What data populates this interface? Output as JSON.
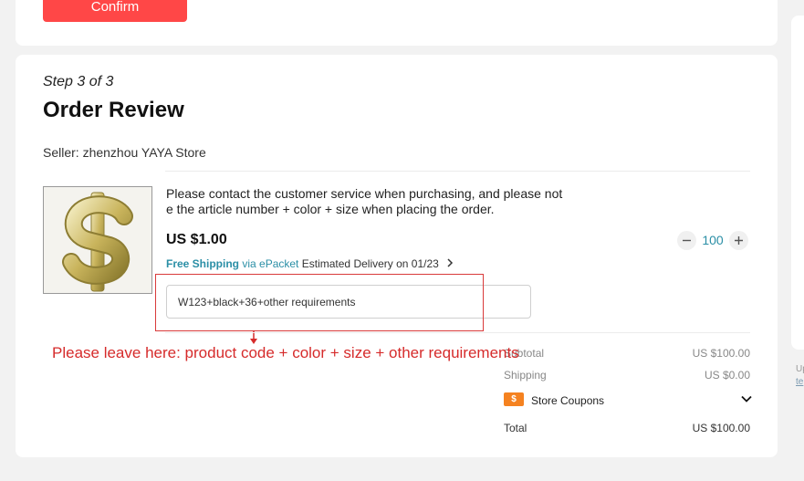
{
  "top": {
    "confirm_label": "Confirm"
  },
  "side": {
    "line1": "Up",
    "line2": "te"
  },
  "order": {
    "step": "Step 3 of 3",
    "title": "Order Review",
    "seller": "Seller: zhenzhou YAYA Store"
  },
  "product": {
    "description_line1": "Please contact the customer service when purchasing, and please not",
    "description_line2": "e the article number + color + size when placing the order.",
    "price": "US $1.00",
    "free_shipping": "Free Shipping",
    "via": "via ePacket",
    "delivery": "Estimated Delivery on 01/23",
    "quantity": "100"
  },
  "remark": {
    "value": "W123+black+36+other requirements"
  },
  "annotation": {
    "text": "Please leave here: product code + color + size + other requirements"
  },
  "summary": {
    "subtotal_label": "Subtotal",
    "subtotal_value": "US $100.00",
    "shipping_label": "Shipping",
    "shipping_value": "US $0.00",
    "coupon_icon": "$",
    "coupons_label": "Store Coupons",
    "total_label": "Total",
    "total_value": "US $100.00"
  },
  "colors": {
    "accent": "#ff4747",
    "link": "#2b8fa6",
    "annotation": "#d62b2b",
    "coupon": "#f58220"
  }
}
